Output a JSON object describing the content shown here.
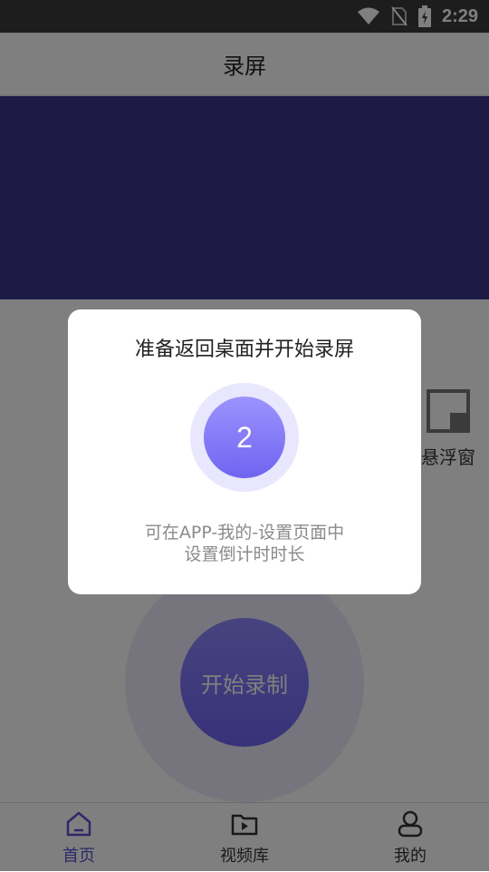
{
  "status": {
    "time": "2:29"
  },
  "header": {
    "title": "录屏"
  },
  "floating": {
    "label": "悬浮窗"
  },
  "record": {
    "label": "开始录制"
  },
  "nav": {
    "items": [
      {
        "label": "首页",
        "active": true
      },
      {
        "label": "视频库"
      },
      {
        "label": "我的"
      }
    ]
  },
  "dialog": {
    "title": "准备返回桌面并开始录屏",
    "countdown": "2",
    "hint_line1": "可在APP-我的-设置页面中",
    "hint_line2": "设置倒计时时长"
  },
  "colors": {
    "accent": "#7a6ff5",
    "banner": "#3a378a",
    "nav_active": "#5a4fd6"
  }
}
